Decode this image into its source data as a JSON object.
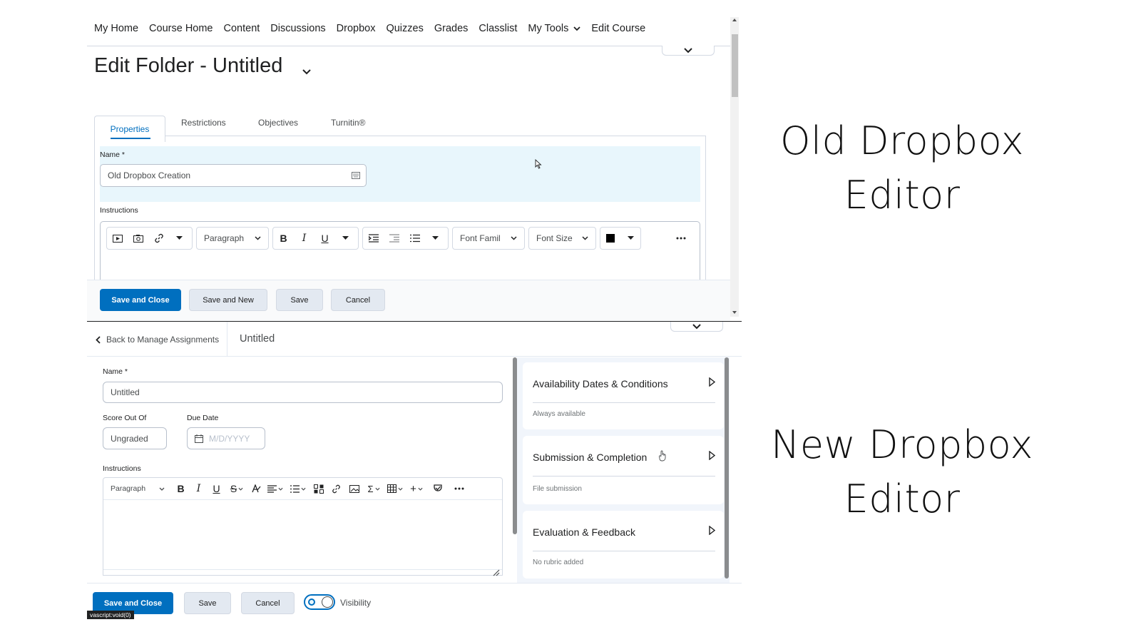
{
  "old_editor": {
    "nav": [
      "My Home",
      "Course Home",
      "Content",
      "Discussions",
      "Dropbox",
      "Quizzes",
      "Grades",
      "Classlist",
      "My Tools",
      "Edit Course"
    ],
    "title": "Edit Folder - Untitled",
    "tabs": [
      "Properties",
      "Restrictions",
      "Objectives",
      "Turnitin®"
    ],
    "name_label": "Name *",
    "name_value": "Old Dropbox Creation",
    "instructions_label": "Instructions",
    "toolbar": {
      "paragraph": "Paragraph",
      "font_family": "Font Famil",
      "font_size": "Font Size"
    },
    "buttons": {
      "save_close": "Save and Close",
      "save_new": "Save and New",
      "save": "Save",
      "cancel": "Cancel"
    }
  },
  "new_editor": {
    "back_link": "Back to Manage Assignments",
    "title": "Untitled",
    "name_label": "Name *",
    "name_value": "Untitled",
    "score_label": "Score Out Of",
    "score_value": "Ungraded",
    "due_label": "Due Date",
    "due_placeholder": "M/D/YYYY",
    "instructions_label": "Instructions",
    "toolbar": {
      "paragraph": "Paragraph"
    },
    "cards": [
      {
        "title": "Availability Dates & Conditions",
        "sub": "Always available"
      },
      {
        "title": "Submission & Completion",
        "sub": "File submission"
      },
      {
        "title": "Evaluation & Feedback",
        "sub": "No rubric added"
      }
    ],
    "buttons": {
      "save_close": "Save and Close",
      "save": "Save",
      "cancel": "Cancel"
    },
    "visibility_label": "Visibility",
    "status_text": "vascript:void(0)"
  },
  "labels": {
    "old_line1": "Old Dropbox",
    "old_line2": "Editor",
    "new_line1": "New Dropbox",
    "new_line2": "Editor"
  }
}
